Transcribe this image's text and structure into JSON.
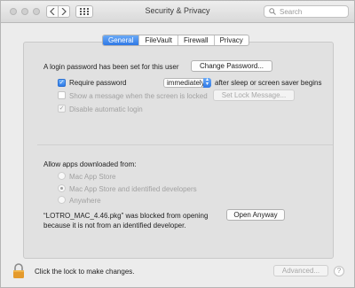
{
  "window": {
    "title": "Security & Privacy",
    "search_placeholder": "Search"
  },
  "tabs": [
    {
      "label": "General",
      "active": true
    },
    {
      "label": "FileVault",
      "active": false
    },
    {
      "label": "Firewall",
      "active": false
    },
    {
      "label": "Privacy",
      "active": false
    }
  ],
  "general": {
    "login_password_text": "A login password has been set for this user",
    "change_password_label": "Change Password...",
    "require_password_label": "Require password",
    "require_password_checked": true,
    "require_password_value": "immediately",
    "require_password_suffix": "after sleep or screen saver begins",
    "show_message_label": "Show a message when the screen is locked",
    "show_message_checked": false,
    "set_lock_message_label": "Set Lock Message...",
    "disable_auto_login_label": "Disable automatic login",
    "disable_auto_login_checked": true
  },
  "apps": {
    "heading": "Allow apps downloaded from:",
    "options": [
      {
        "label": "Mac App Store",
        "selected": false
      },
      {
        "label": "Mac App Store and identified developers",
        "selected": true
      },
      {
        "label": "Anywhere",
        "selected": false
      }
    ],
    "blocked_line1": "“LOTRO_MAC_4.46.pkg” was blocked from opening",
    "blocked_line2": "because it is not from an identified developer.",
    "open_anyway_label": "Open Anyway"
  },
  "footer": {
    "lock_text": "Click the lock to make changes.",
    "advanced_label": "Advanced...",
    "help_label": "?"
  },
  "colors": {
    "accent": "#2f78e5",
    "lock": "#e49a2c"
  },
  "icons": [
    "back-icon",
    "forward-icon",
    "grid-icon",
    "search-icon",
    "lock-icon",
    "help-icon",
    "checkmark-icon"
  ]
}
